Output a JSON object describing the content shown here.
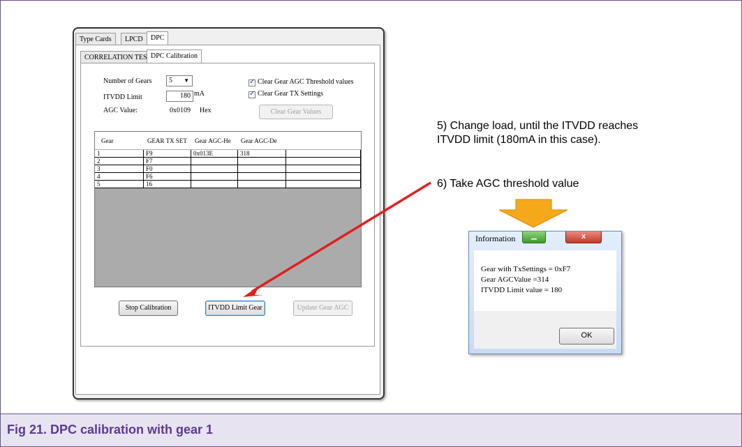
{
  "caption": "Fig 21.   DPC calibration with gear 1",
  "tabs": {
    "top": [
      "Type Cards",
      "LPCD",
      "DPC"
    ],
    "sub": [
      "CORRELATION TEST",
      "DPC Calibration"
    ]
  },
  "settings": {
    "gears_label": "Number of Gears",
    "gears_value": "5",
    "itvdd_label": "ITVDD Limit",
    "itvdd_value": "180",
    "itvdd_unit": "mA",
    "agc_label": "AGC Value:",
    "agc_value": "0x0109",
    "agc_unit": "Hex",
    "chk_threshold": "Clear Gear AGC Threshold values",
    "chk_tx": "Clear Gear TX Settings",
    "clear_btn": "Clear Gear Values"
  },
  "table": {
    "headers": [
      "Gear",
      "GEAR TX SET",
      "Gear AGC-He",
      "Gear AGC-De"
    ],
    "rows": [
      [
        "1",
        "F9",
        "0x013E",
        "318"
      ],
      [
        "2",
        "F7",
        "",
        ""
      ],
      [
        "3",
        "F0",
        "",
        ""
      ],
      [
        "4",
        "F6",
        "",
        ""
      ],
      [
        "5",
        "16",
        "",
        ""
      ]
    ]
  },
  "buttons": {
    "stop": "Stop Calibration",
    "itvdd_gear": "ITVDD Limit Gear",
    "update": "Update Gear AGC"
  },
  "notes": {
    "step5_line1": "5) Change load, until the ITVDD reaches",
    "step5_line2": "ITVDD limit (180mA in this case).",
    "step6": "6) Take AGC threshold value"
  },
  "dialog": {
    "title": "Information",
    "close": "x",
    "line1": "Gear with TxSettings = 0xF7",
    "line2": "Gear AGCValue =314",
    "line3": "ITVDD Limit value = 180",
    "ok": "OK"
  }
}
